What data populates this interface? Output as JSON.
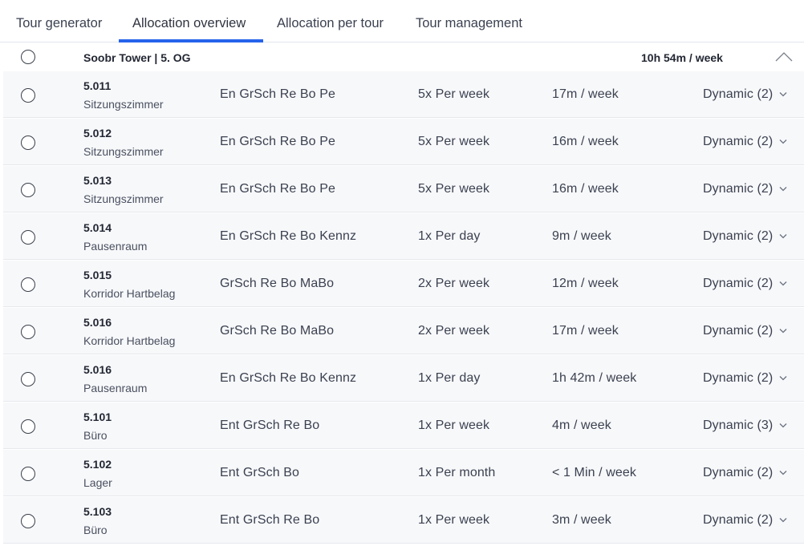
{
  "tabs": [
    {
      "label": "Tour generator",
      "active": false
    },
    {
      "label": "Allocation overview",
      "active": true
    },
    {
      "label": "Allocation per tour",
      "active": false
    },
    {
      "label": "Tour management",
      "active": false
    }
  ],
  "colors": {
    "accent": "#2563eb",
    "row_bg": "#f7f8fa",
    "border": "#e6e8ed"
  },
  "group": {
    "title": "Soobr Tower | 5. OG",
    "total": "10h 54m / week",
    "collapse_icon": "chevron-up-icon"
  },
  "rows": [
    {
      "id": "5.011",
      "type": "Sitzungszimmer",
      "tasks": "En GrSch Re Bo Pe",
      "frequency": "5x Per week",
      "time": "17m / week",
      "mode": "Dynamic (2)"
    },
    {
      "id": "5.012",
      "type": "Sitzungszimmer",
      "tasks": "En GrSch Re Bo Pe",
      "frequency": "5x Per week",
      "time": "16m / week",
      "mode": "Dynamic (2)"
    },
    {
      "id": "5.013",
      "type": "Sitzungszimmer",
      "tasks": "En GrSch Re Bo Pe",
      "frequency": "5x Per week",
      "time": "16m / week",
      "mode": "Dynamic (2)"
    },
    {
      "id": "5.014",
      "type": "Pausenraum",
      "tasks": "En GrSch Re Bo Kennz",
      "frequency": "1x Per day",
      "time": "9m / week",
      "mode": "Dynamic (2)"
    },
    {
      "id": "5.015",
      "type": "Korridor Hartbelag",
      "tasks": "GrSch Re Bo MaBo",
      "frequency": "2x Per week",
      "time": "12m / week",
      "mode": "Dynamic (2)"
    },
    {
      "id": "5.016",
      "type": "Korridor Hartbelag",
      "tasks": "GrSch Re Bo MaBo",
      "frequency": "2x Per week",
      "time": "17m / week",
      "mode": "Dynamic (2)"
    },
    {
      "id": "5.016",
      "type": "Pausenraum",
      "tasks": "En GrSch Re Bo Kennz",
      "frequency": "1x Per day",
      "time": "1h 42m / week",
      "mode": "Dynamic (2)"
    },
    {
      "id": "5.101",
      "type": "Büro",
      "tasks": "Ent GrSch Re Bo",
      "frequency": "1x Per week",
      "time": "4m / week",
      "mode": "Dynamic (3)"
    },
    {
      "id": "5.102",
      "type": "Lager",
      "tasks": "Ent GrSch Bo",
      "frequency": "1x Per month",
      "time": "< 1 Min / week",
      "mode": "Dynamic (2)"
    },
    {
      "id": "5.103",
      "type": "Büro",
      "tasks": "Ent GrSch Re Bo",
      "frequency": "1x Per week",
      "time": "3m / week",
      "mode": "Dynamic (2)"
    }
  ]
}
